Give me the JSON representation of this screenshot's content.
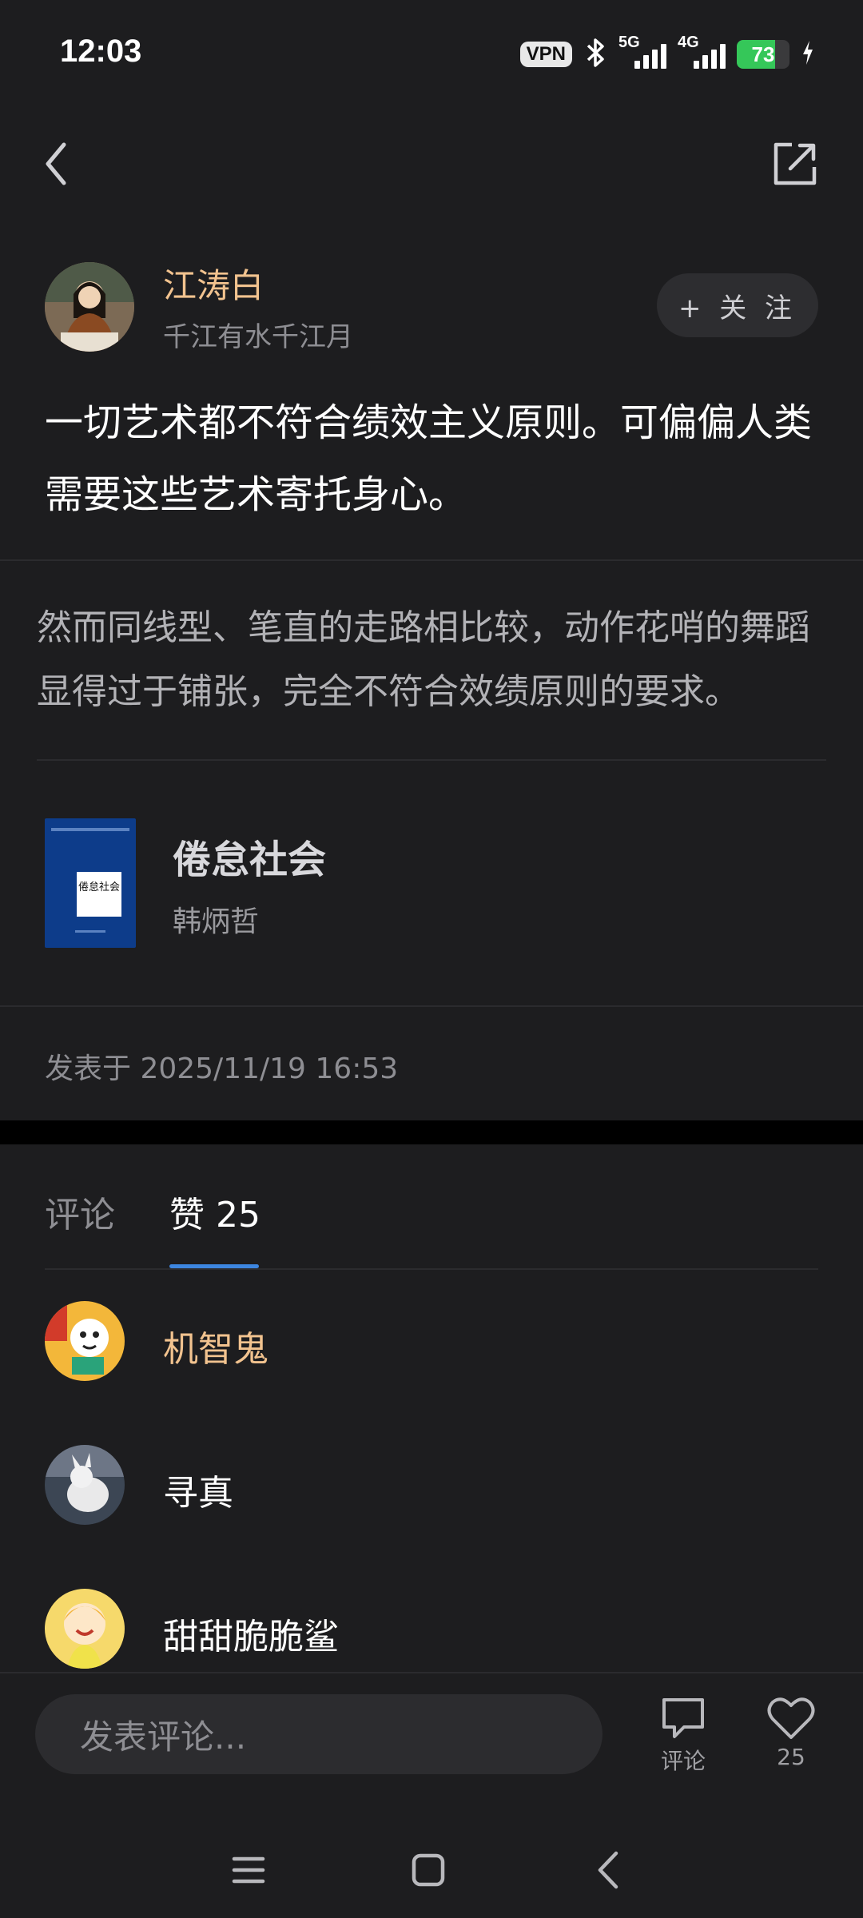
{
  "status_bar": {
    "time": "12:03",
    "vpn": "VPN",
    "net1": "5G",
    "net2": "4G",
    "battery": "73",
    "battery_level": 0.73,
    "battery_color": "#35c759"
  },
  "nav": {
    "back_icon": "chevron-left-icon",
    "share_icon": "share-external-icon"
  },
  "author": {
    "name": "江涛白",
    "signature": "千江有水千江月",
    "follow_label": "+ 关 注",
    "name_color": "#f2c38f"
  },
  "post": {
    "text": "一切艺术都不符合绩效主义原则。可偏偏人类需要这些艺术寄托身心。",
    "quote": "然而同线型、笔直的走路相比较，动作花哨的舞蹈显得过于铺张，完全不符合效绩原则的要求。",
    "time": "发表于 2025/11/19 16:53"
  },
  "book": {
    "title": "倦怠社会",
    "author": "韩炳哲",
    "cover_title": "倦怠社会",
    "cover_color": "#0d3c8a"
  },
  "tabs": {
    "comments": "评论",
    "likes": "赞 25",
    "indicator_color": "#3d86e0"
  },
  "likes": [
    {
      "name": "机智鬼",
      "color": "#f2c38f"
    },
    {
      "name": "寻真",
      "color": "#ffffff"
    },
    {
      "name": "甜甜脆脆鲨",
      "color": "#ffffff"
    }
  ],
  "bottom": {
    "input_placeholder": "发表评论...",
    "comment_label": "评论",
    "like_count": "25"
  },
  "system_nav": {
    "menu_icon": "menu-icon",
    "home_icon": "home-square-icon",
    "back_icon": "back-triangle-icon"
  }
}
